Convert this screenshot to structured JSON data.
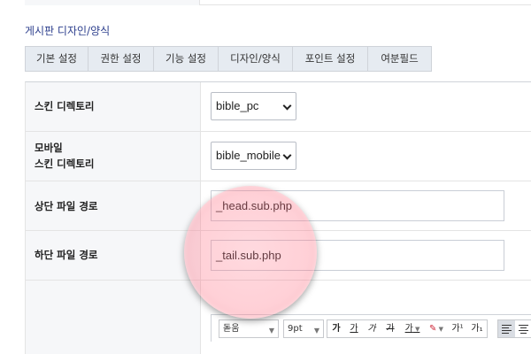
{
  "section": {
    "title": "게시판 디자인/양식"
  },
  "tabs": [
    {
      "label": "기본 설정"
    },
    {
      "label": "권한 설정"
    },
    {
      "label": "기능 설정"
    },
    {
      "label": "디자인/양식"
    },
    {
      "label": "포인트 설정"
    },
    {
      "label": "여분필드"
    }
  ],
  "form": {
    "skin_dir": {
      "label": "스킨 디렉토리",
      "value": "bible_pc"
    },
    "mobile_skin_dir": {
      "label_line1": "모바일",
      "label_line2": "스킨 디렉토리",
      "value": "bible_mobile"
    },
    "head_path": {
      "label": "상단 파일 경로",
      "value": "_head.sub.php"
    },
    "tail_path": {
      "label": "하단 파일 경로",
      "value": "_tail.sub.php"
    }
  },
  "editor": {
    "font_name": "돋움",
    "font_size": "9pt",
    "buttons": {
      "bold": "가",
      "underline": "가",
      "italic": "가",
      "strike": "가",
      "text_color": "가",
      "superscript": "가¹",
      "subscript": "가₁"
    }
  }
}
